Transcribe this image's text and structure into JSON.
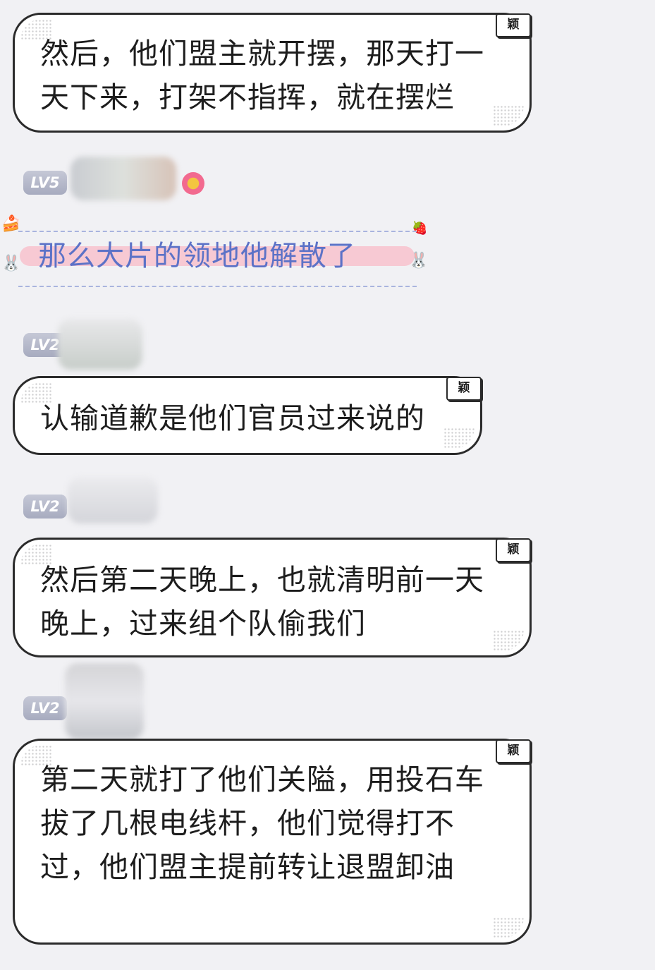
{
  "messages": [
    {
      "tag": "颖",
      "text": "然后，他们盟主就开摆，那天打一天下来，打架不指挥，就在摆烂"
    },
    {
      "level": "LV5",
      "text": "那么大片的领地他解散了"
    },
    {
      "level": "LV2",
      "tag": "颖",
      "text": "认输道歉是他们官员过来说的"
    },
    {
      "level": "LV2",
      "tag": "颖",
      "text": "然后第二天晚上，也就清明前一天晚上，过来组个队偷我们"
    },
    {
      "level": "LV2",
      "tag": "颖",
      "text": "第二天就打了他们关隘，用投石车拔了几根电线杆，他们觉得打不过，他们盟主提前转让退盟卸油"
    }
  ]
}
